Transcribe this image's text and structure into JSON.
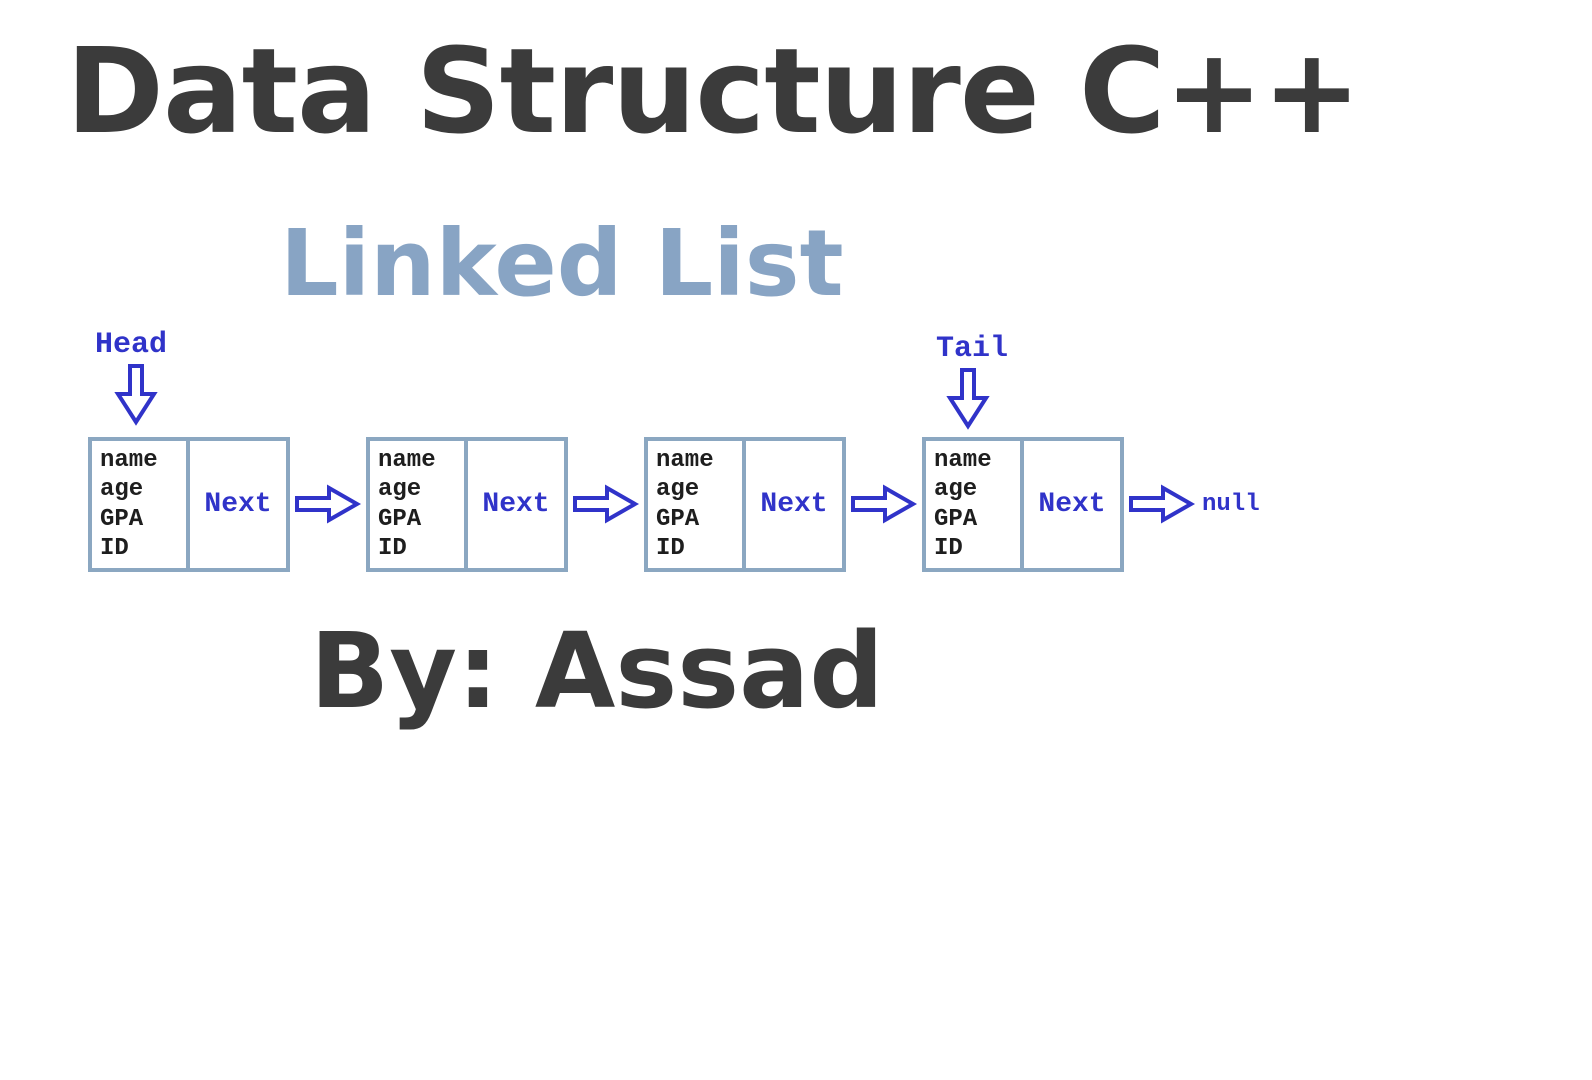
{
  "title": "Data Structure C++",
  "subtitle": "Linked List",
  "byline": "By: Assad",
  "pointers": {
    "head_label": "Head",
    "tail_label": "Tail"
  },
  "node_fields": [
    "name",
    "age",
    "GPA",
    "ID"
  ],
  "next_label": "Next",
  "null_label": "null",
  "node_count": 4,
  "head_index": 0,
  "tail_index": 3,
  "colors": {
    "title": "#3b3b3b",
    "subtitle": "#88a4c4",
    "node_border": "#8ba7c1",
    "arrow": "#3033c9",
    "mono_text": "#1e1e1e"
  }
}
